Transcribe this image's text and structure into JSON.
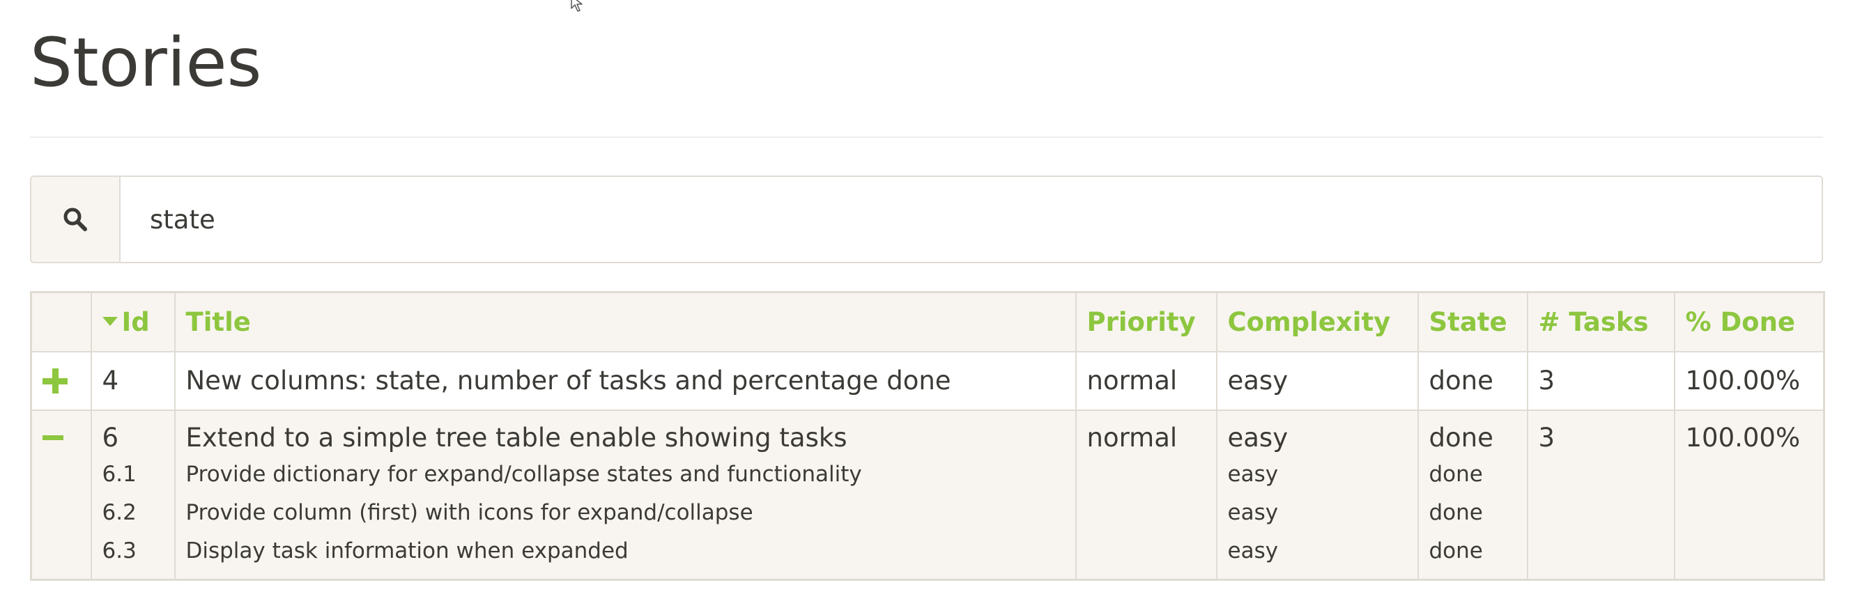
{
  "page": {
    "title": "Stories"
  },
  "search": {
    "value": "state",
    "icon": "search-icon"
  },
  "table": {
    "headers": {
      "toggle": "",
      "id": "Id",
      "title": "Title",
      "priority": "Priority",
      "complexity": "Complexity",
      "state": "State",
      "tasks": "# Tasks",
      "done": "% Done"
    },
    "sort": {
      "column": "Id",
      "direction": "descending"
    },
    "rows": [
      {
        "expanded": false,
        "toggle_icon": "plus-icon",
        "id": "4",
        "title": "New columns: state, number of tasks and percentage done",
        "priority": "normal",
        "complexity": "easy",
        "state": "done",
        "tasks": "3",
        "done": "100.00%",
        "subtasks": []
      },
      {
        "expanded": true,
        "toggle_icon": "minus-icon",
        "id": "6",
        "title": "Extend to a simple tree table enable showing tasks",
        "priority": "normal",
        "complexity": "easy",
        "state": "done",
        "tasks": "3",
        "done": "100.00%",
        "subtasks": [
          {
            "id": "6.1",
            "title": "Provide dictionary for expand/collapse states and functionality",
            "complexity": "easy",
            "state": "done"
          },
          {
            "id": "6.2",
            "title": "Provide column (first) with icons for expand/collapse",
            "complexity": "easy",
            "state": "done"
          },
          {
            "id": "6.3",
            "title": "Display task information when expanded",
            "complexity": "easy",
            "state": "done"
          }
        ]
      }
    ]
  },
  "colors": {
    "accent_green": "#8dc63f",
    "header_bg": "#f8f5f0",
    "border": "#dfdbd3",
    "text": "#3b3a36"
  }
}
